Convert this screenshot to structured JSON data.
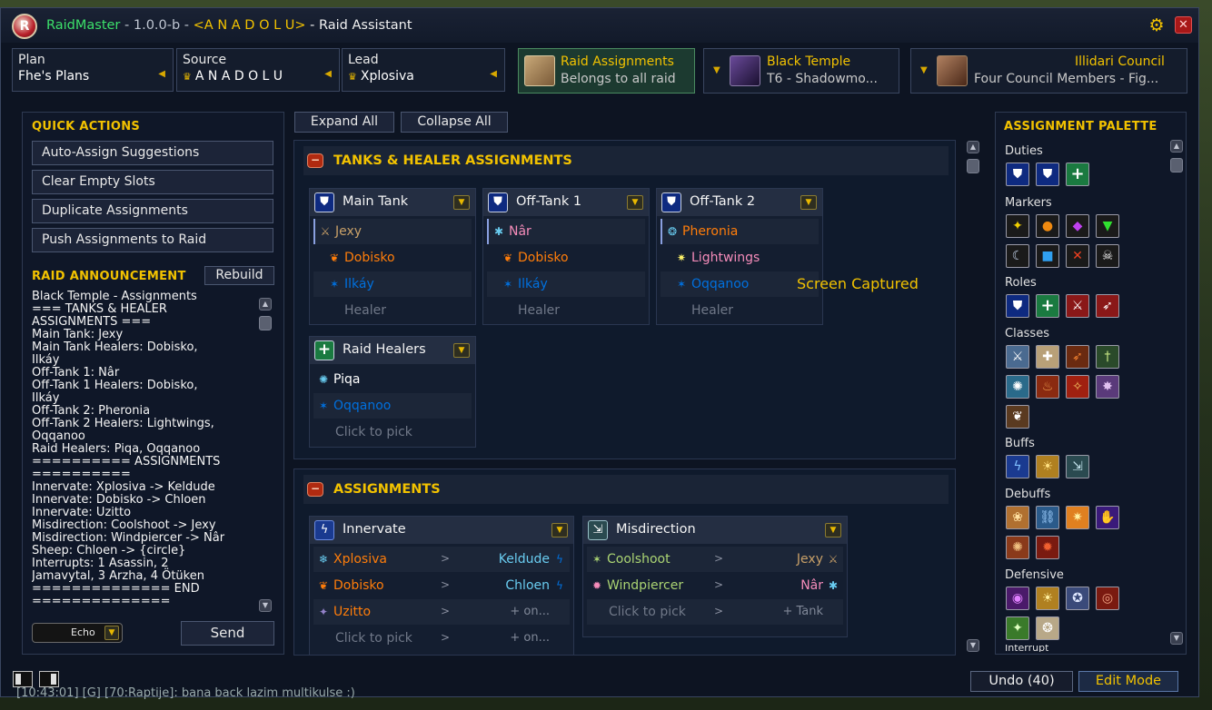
{
  "window": {
    "app_name": "RaidMaster",
    "version": " - 1.0.0-b - ",
    "guild": "<A N A D O L U>",
    "subtitle": " - Raid Assistant",
    "logo_letter": "R"
  },
  "selectors": {
    "plan": {
      "label": "Plan",
      "value": "Fhe's Plans"
    },
    "source": {
      "label": "Source",
      "value": "A N A D O L U"
    },
    "lead": {
      "label": "Lead",
      "value": "Xplosiva"
    }
  },
  "cards": {
    "raid_assignments": {
      "title": "Raid Assignments",
      "sub": "Belongs to all raid"
    },
    "instance": {
      "title": "Black Temple",
      "sub": "T6  -  Shadowmo..."
    },
    "encounter": {
      "title": "Illidari Council",
      "sub": "Four Council Members  -  Fig..."
    }
  },
  "quick_actions": {
    "header": "QUICK ACTIONS",
    "buttons": [
      "Auto-Assign Suggestions",
      "Clear Empty Slots",
      "Duplicate Assignments",
      "Push Assignments to Raid"
    ]
  },
  "announcement": {
    "header": "RAID ANNOUNCEMENT",
    "rebuild": "Rebuild",
    "text": "Black Temple - Assignments\n=== TANKS & HEALER\nASSIGNMENTS ===\nMain Tank: Jexy\nMain Tank Healers: Dobisko,\nIlkáy\nOff-Tank 1: Nâr\nOff-Tank 1 Healers: Dobisko,\nIlkáy\nOff-Tank 2: Pheronia\nOff-Tank 2 Healers: Lightwings,\nOqqanoo\nRaid Healers: Piqa, Oqqanoo\n========== ASSIGNMENTS\n==========\nInnervate: Xplosiva -> Keldude\nInnervate: Dobisko -> Chloen\nInnervate: Uzitto\nMisdirection: Coolshoot -> Jexy\nMisdirection: Windpiercer -> Nâr\nSheep: Chloen -> {circle}\nInterrupts: 1 Asassin, 2\nJamavytal, 3 Arzha, 4 Ötüken\n============== END\n==============",
    "channel": "Echo",
    "send": "Send"
  },
  "toolbar": {
    "expand": "Expand All",
    "collapse": "Collapse All"
  },
  "tanks_group": {
    "title": "TANKS & HEALER ASSIGNMENTS",
    "main_tank": {
      "title": "Main Tank",
      "tank": "Jexy",
      "healers": [
        "Dobisko",
        "Ilkáy"
      ],
      "empty": "Healer"
    },
    "off_tank_1": {
      "title": "Off-Tank 1",
      "tank": "Nâr",
      "healers": [
        "Dobisko",
        "Ilkáy"
      ],
      "empty": "Healer"
    },
    "off_tank_2": {
      "title": "Off-Tank 2",
      "tank": "Pheronia",
      "healers": [
        "Lightwings",
        "Oqqanoo"
      ],
      "empty": "Healer"
    },
    "raid_healers": {
      "title": "Raid Healers",
      "healers": [
        "Piqa",
        "Oqqanoo"
      ],
      "empty": "Click to pick"
    }
  },
  "assign_group": {
    "title": "ASSIGNMENTS",
    "gt": ">",
    "innervate": {
      "title": "Innervate",
      "rows": [
        {
          "from": "Xplosiva",
          "to": "Keldude"
        },
        {
          "from": "Dobisko",
          "to": "Chloen"
        },
        {
          "from": "Uzitto",
          "to": "+ on..."
        },
        {
          "from": "Click to pick",
          "to": "+ on..."
        }
      ]
    },
    "misdirection": {
      "title": "Misdirection",
      "rows": [
        {
          "from": "Coolshoot",
          "to": "Jexy"
        },
        {
          "from": "Windpiercer",
          "to": "Nâr"
        },
        {
          "from": "Click to pick",
          "to": "+ Tank"
        }
      ]
    }
  },
  "captured_label": "Screen Captured",
  "palette": {
    "header": "ASSIGNMENT PALETTE",
    "sections": [
      "Duties",
      "Markers",
      "Roles",
      "Classes",
      "Buffs",
      "Debuffs",
      "Defensive",
      "Interrupt"
    ]
  },
  "bottom": {
    "undo": "Undo  (40)",
    "edit_mode": "Edit Mode"
  },
  "chat_line": "[10:43:01] [G] [70:Raptije]: bana back lazim multikulse :)",
  "colors": {
    "accent": "#f2c200",
    "title_green": "#3ce06a",
    "panel": "#0f1728"
  }
}
